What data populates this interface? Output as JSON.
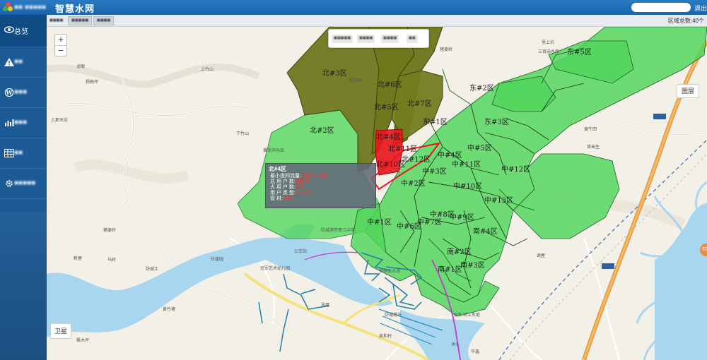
{
  "app": {
    "title": "智慧水网",
    "brand_blurred": "■■ ■■■■■",
    "logout": "退出",
    "colors": {
      "topbar": "#1f6fb6",
      "sidebar": "#1c5a96",
      "zone_green": "#4fd65a",
      "zone_olive": "#6b7419",
      "zone_red": "#e8171f",
      "road_orange": "#f2a23a"
    }
  },
  "sidebar": {
    "items": [
      {
        "icon": "eye-icon",
        "label": "总览",
        "active": true
      },
      {
        "icon": "warning-icon",
        "label": "■■",
        "blurred": true
      },
      {
        "icon": "wordpress-icon",
        "label": "■■■",
        "blurred": true
      },
      {
        "icon": "bar-chart-icon",
        "label": "■■■",
        "blurred": true
      },
      {
        "icon": "table-icon",
        "label": "■■",
        "blurred": true
      },
      {
        "icon": "gear-icon",
        "label": "■■■■■",
        "blurred": true
      }
    ]
  },
  "breadcrumb": {
    "home": "■■■■",
    "tabs": [
      "■■■■■",
      "■■■■"
    ],
    "area_total": "区域总数:40个"
  },
  "map": {
    "zoom_in": "+",
    "zoom_out": "−",
    "toolbar": [
      "■■■■■",
      "■■■■",
      "■■■■",
      "■■"
    ],
    "layers_button": "图层",
    "satellite_button": "卫星",
    "edge_marker": "52",
    "zones": [
      {
        "name": "北#3区"
      },
      {
        "name": "北#6区"
      },
      {
        "name": "北#7区"
      },
      {
        "name": "北#5区"
      },
      {
        "name": "北#2区"
      },
      {
        "name": "北#4区"
      },
      {
        "name": "北#11区"
      },
      {
        "name": "北#12区"
      },
      {
        "name": "北#10区"
      },
      {
        "name": "东#2区"
      },
      {
        "name": "东#5区"
      },
      {
        "name": "东#1区"
      },
      {
        "name": "东#3区"
      },
      {
        "name": "中#4区"
      },
      {
        "name": "中#5区"
      },
      {
        "name": "中#11区"
      },
      {
        "name": "中#12区"
      },
      {
        "name": "中#3区"
      },
      {
        "name": "中#2区"
      },
      {
        "name": "中#10区"
      },
      {
        "name": "中#13区"
      },
      {
        "name": "中#8区"
      },
      {
        "name": "中#9区"
      },
      {
        "name": "中#1区"
      },
      {
        "name": "中#6区"
      },
      {
        "name": "中#7区"
      },
      {
        "name": "南#4区"
      },
      {
        "name": "南#2区"
      },
      {
        "name": "南#1区"
      },
      {
        "name": "南#3区"
      }
    ],
    "places": [
      "龙眼",
      "杨梅坪",
      "上那天坑",
      "上竹山",
      "下竹山",
      "黄泥冲水库",
      "区政府",
      "猪婆岭",
      "三官庙水库",
      "里上坑",
      "黄牛田",
      "草米生",
      "猪婆岭",
      "新屋",
      "马岭",
      "防城江",
      "长盘园",
      "冠军艺术幼儿园",
      "黄竹塘",
      "枫木坪",
      "防城港市第三中学",
      "恒祥发水湾",
      "东南·滨江名庭",
      "沖头",
      "防城港市",
      "公交站",
      "谢屋",
      "苏屋",
      "泉和村",
      "华鑫"
    ],
    "popup": {
      "title": "北#4区",
      "rows": [
        {
          "label": "最小夜间流量:",
          "value": "23.271 m³/h"
        },
        {
          "label": "总 用 户 数:",
          "value": "580 户"
        },
        {
          "label": "大 用 户 数:",
          "value": "0 户"
        },
        {
          "label": "用 户 类 型:",
          "value": "居民混合"
        },
        {
          "label": "管        材:",
          "value": "铸铁"
        }
      ]
    }
  }
}
